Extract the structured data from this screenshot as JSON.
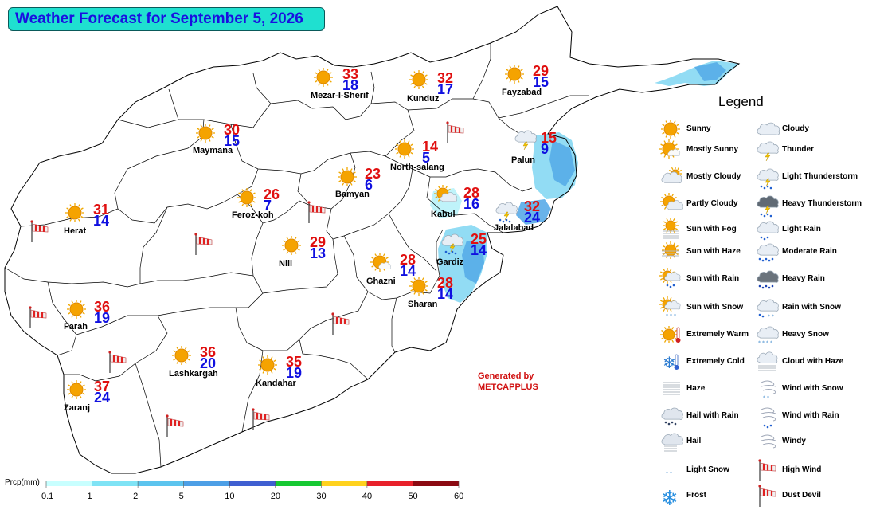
{
  "title": "Weather Forecast for September 5, 2026",
  "cities": [
    {
      "name": "Mezar-I-Sherif",
      "max": "33",
      "min": "18",
      "icon": "sunny"
    },
    {
      "name": "Kunduz",
      "max": "32",
      "min": "17",
      "icon": "sunny"
    },
    {
      "name": "Fayzabad",
      "max": "29",
      "min": "15",
      "icon": "sunny"
    },
    {
      "name": "Maymana",
      "max": "30",
      "min": "15",
      "icon": "sunny"
    },
    {
      "name": "North-salang",
      "max": "14",
      "min": "5",
      "icon": "sunny"
    },
    {
      "name": "Palun",
      "max": "15",
      "min": "9",
      "icon": "thunder"
    },
    {
      "name": "Bamyan",
      "max": "23",
      "min": "6",
      "icon": "sunny"
    },
    {
      "name": "Feroz-koh",
      "max": "26",
      "min": "7",
      "icon": "sunny"
    },
    {
      "name": "Kabul",
      "max": "28",
      "min": "16",
      "icon": "partly-cloudy"
    },
    {
      "name": "Jalalabad",
      "max": "32",
      "min": "24",
      "icon": "light-thunderstorm"
    },
    {
      "name": "Herat",
      "max": "31",
      "min": "14",
      "icon": "sunny"
    },
    {
      "name": "Nili",
      "max": "29",
      "min": "13",
      "icon": "sunny"
    },
    {
      "name": "Gardiz",
      "max": "25",
      "min": "14",
      "icon": "light-thunderstorm"
    },
    {
      "name": "Ghazni",
      "max": "28",
      "min": "14",
      "icon": "mostly-sunny"
    },
    {
      "name": "Sharan",
      "max": "28",
      "min": "14",
      "icon": "sunny"
    },
    {
      "name": "Farah",
      "max": "36",
      "min": "19",
      "icon": "sunny"
    },
    {
      "name": "Lashkargah",
      "max": "36",
      "min": "20",
      "icon": "sunny"
    },
    {
      "name": "Kandahar",
      "max": "35",
      "min": "19",
      "icon": "sunny"
    },
    {
      "name": "Zaranj",
      "max": "37",
      "min": "24",
      "icon": "sunny"
    }
  ],
  "legend": {
    "title": "Legend",
    "items": [
      {
        "label": "Sunny",
        "icon": "sunny"
      },
      {
        "label": "Cloudy",
        "icon": "cloudy"
      },
      {
        "label": "Mostly Sunny",
        "icon": "mostly-sunny"
      },
      {
        "label": "Thunder",
        "icon": "thunder"
      },
      {
        "label": "Mostly Cloudy",
        "icon": "mostly-cloudy"
      },
      {
        "label": "Light Thunderstorm",
        "icon": "light-thunderstorm"
      },
      {
        "label": "Partly Cloudy",
        "icon": "partly-cloudy"
      },
      {
        "label": "Heavy Thunderstorm",
        "icon": "heavy-thunderstorm"
      },
      {
        "label": "Sun with Fog",
        "icon": "sun-fog"
      },
      {
        "label": "Light Rain",
        "icon": "light-rain"
      },
      {
        "label": "Sun with Haze",
        "icon": "sun-haze"
      },
      {
        "label": "Moderate Rain",
        "icon": "moderate-rain"
      },
      {
        "label": "Sun with Rain",
        "icon": "sun-rain"
      },
      {
        "label": "Heavy Rain",
        "icon": "heavy-rain"
      },
      {
        "label": "Sun with Snow",
        "icon": "sun-snow"
      },
      {
        "label": "Rain with Snow",
        "icon": "rain-snow"
      },
      {
        "label": "Extremely Warm",
        "icon": "extremely-warm"
      },
      {
        "label": "Heavy Snow",
        "icon": "heavy-snow"
      },
      {
        "label": "Extremely Cold",
        "icon": "extremely-cold"
      },
      {
        "label": "Cloud with Haze",
        "icon": "cloud-haze"
      },
      {
        "label": "Haze",
        "icon": "haze"
      },
      {
        "label": "Wind with Snow",
        "icon": "wind-snow"
      },
      {
        "label": "Hail with Rain",
        "icon": "hail-rain"
      },
      {
        "label": "Wind with Rain",
        "icon": "wind-rain"
      },
      {
        "label": "Hail",
        "icon": "hail"
      },
      {
        "label": "Windy",
        "icon": "windy"
      },
      {
        "label": "Light Snow",
        "icon": "light-snow"
      },
      {
        "label": "High Wind",
        "icon": "high-wind"
      },
      {
        "label": "Frost",
        "icon": "frost"
      },
      {
        "label": "Dust Devil",
        "icon": "dust-devil"
      }
    ]
  },
  "generated_by": {
    "line1": "Generated by",
    "line2": "METCAPPLUS"
  },
  "colorbar": {
    "label": "Prcp(mm)",
    "ticks": [
      "0.1",
      "1",
      "2",
      "5",
      "10",
      "20",
      "30",
      "40",
      "50",
      "60"
    ],
    "colors": [
      "#c8ffff",
      "#7fe3f5",
      "#5cc4ee",
      "#4d9fe6",
      "#3f5fd1",
      "#16c832",
      "#ffd21e",
      "#e8212b",
      "#8b0a12"
    ]
  }
}
